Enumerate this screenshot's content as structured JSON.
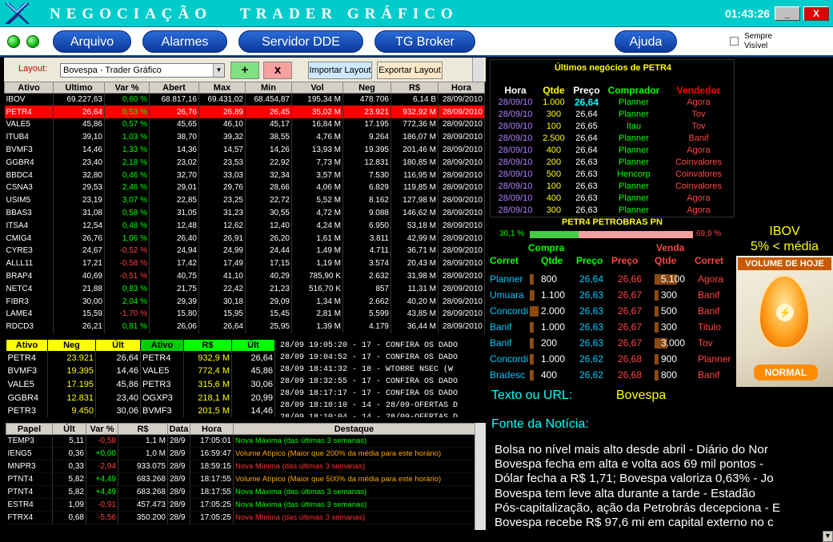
{
  "window": {
    "title": "NEGOCIAÇÃO   TRADER GRÁFICO",
    "clock": "01:43:26",
    "min_label": "_",
    "close_label": "X"
  },
  "menu": {
    "items": [
      "Arquivo",
      "Alarmes",
      "Servidor DDE",
      "TG Broker",
      "Ajuda"
    ],
    "checkbox_label": "Sempre Visível"
  },
  "layout_bar": {
    "label": "Layout:",
    "selected": "Bovespa - Trader Gráfico",
    "add_label": "+",
    "remove_label": "x",
    "import_label": "Importar Layout",
    "export_label": "Exportar Layout"
  },
  "colors": {
    "accent": "#00cccc",
    "button_blue": "#1a55c8",
    "selected_row": "#ff0000",
    "positive": "#00ff00",
    "negative": "#ff4040"
  },
  "quotes": {
    "headers": [
      "Ativo",
      "Ultimo",
      "Var %",
      "Abert",
      "Max",
      "Min",
      "Vol",
      "Neg",
      "R$",
      "Hora"
    ],
    "rows": [
      [
        "IBOV",
        "69.227,63",
        "0,60 %",
        "68.817,16",
        "69.431,02",
        "68.454,87",
        "195,34 M",
        "478.706",
        "6,14 B",
        "28/09/2010"
      ],
      [
        "PETR4",
        "26,64",
        "0,53 %",
        "26,76",
        "26,89",
        "26,45",
        "35,02 M",
        "23.921",
        "932,92 M",
        "28/09/2010"
      ],
      [
        "VALE5",
        "45,86",
        "0,57 %",
        "45,65",
        "46,10",
        "45,17",
        "16,84 M",
        "17.195",
        "772,36 M",
        "28/09/2010"
      ],
      [
        "ITUB4",
        "39,10",
        "1,03 %",
        "38,70",
        "39,32",
        "38,55",
        "4,76 M",
        "9.264",
        "186,07 M",
        "28/09/2010"
      ],
      [
        "BVMF3",
        "14,46",
        "1,33 %",
        "14,36",
        "14,57",
        "14,26",
        "13,93 M",
        "19.395",
        "201,46 M",
        "28/09/2010"
      ],
      [
        "GGBR4",
        "23,40",
        "2,18 %",
        "23,02",
        "23,53",
        "22,92",
        "7,73 M",
        "12.831",
        "180,85 M",
        "28/09/2010"
      ],
      [
        "BBDC4",
        "32,80",
        "0,46 %",
        "32,70",
        "33,03",
        "32,34",
        "3,57 M",
        "7.530",
        "116,95 M",
        "28/09/2010"
      ],
      [
        "CSNA3",
        "29,53",
        "2,46 %",
        "29,01",
        "29,76",
        "28,66",
        "4,06 M",
        "6.829",
        "119,85 M",
        "28/09/2010"
      ],
      [
        "USIM5",
        "23,19",
        "3,07 %",
        "22,85",
        "23,25",
        "22,72",
        "5,52 M",
        "8.162",
        "127,98 M",
        "28/09/2010"
      ],
      [
        "BBAS3",
        "31,08",
        "0,58 %",
        "31,05",
        "31,23",
        "30,55",
        "4,72 M",
        "9.088",
        "146,62 M",
        "28/09/2010"
      ],
      [
        "ITSA4",
        "12,54",
        "0,48 %",
        "12,48",
        "12,62",
        "12,40",
        "4,24 M",
        "6.950",
        "53,18 M",
        "28/09/2010"
      ],
      [
        "CMIG4",
        "26,76",
        "1,06 %",
        "26,40",
        "26,91",
        "26,20",
        "1,61 M",
        "3.811",
        "42,99 M",
        "28/09/2010"
      ],
      [
        "CYRE3",
        "24,67",
        "-0,52 %",
        "24,94",
        "24,99",
        "24,44",
        "1,49 M",
        "4.711",
        "36,71 M",
        "28/09/2010"
      ],
      [
        "ALLL11",
        "17,21",
        "-0,58 %",
        "17,42",
        "17,49",
        "17,15",
        "1,19 M",
        "3.574",
        "20,43 M",
        "28/09/2010"
      ],
      [
        "BRAP4",
        "40,69",
        "-0,51 %",
        "40,75",
        "41,10",
        "40,29",
        "785,90 K",
        "2.632",
        "31,98 M",
        "28/09/2010"
      ],
      [
        "NETC4",
        "21,88",
        "0,83 %",
        "21,75",
        "22,42",
        "21,23",
        "516,70 K",
        "857",
        "11,31 M",
        "28/09/2010"
      ],
      [
        "FIBR3",
        "30,00",
        "2,04 %",
        "29,39",
        "30,18",
        "29,09",
        "1,34 M",
        "2.662",
        "40,20 M",
        "28/09/2010"
      ],
      [
        "LAME4",
        "15,59",
        "-1,70 %",
        "15,80",
        "15,95",
        "15,45",
        "2,81 M",
        "5.599",
        "43,85 M",
        "28/09/2010"
      ],
      [
        "RDCD3",
        "26,21",
        "0,81 %",
        "26,06",
        "26,64",
        "25,95",
        "1,39 M",
        "4.179",
        "36,44 M",
        "28/09/2010"
      ]
    ]
  },
  "ranking": {
    "headers": [
      "Ativo",
      "Neg",
      "Últ",
      "Ativo",
      "R$",
      "Últ"
    ],
    "rows": [
      [
        "PETR4",
        "23.921",
        "26,64",
        "PETR4",
        "932,9 M",
        "26,64"
      ],
      [
        "BVMF3",
        "19.395",
        "14,46",
        "VALE5",
        "772,4 M",
        "45,86"
      ],
      [
        "VALE5",
        "17.195",
        "45,86",
        "PETR3",
        "315,6 M",
        "30,06"
      ],
      [
        "GGBR4",
        "12.831",
        "23,40",
        "OGXP3",
        "218,1 M",
        "20,99"
      ],
      [
        "PETR3",
        "9.450",
        "30,06",
        "BVMF3",
        "201,5 M",
        "14,46"
      ]
    ]
  },
  "ticker": [
    "28/09 19:05:20 - 17 - CONFIRA OS DADO",
    "28/09 19:04:52 - 17 - CONFIRA OS DADO",
    "28/09 18:41:32 - 18 - WTORRE NSEC (W",
    "28/09 18:32:55 - 17 - CONFIRA OS DADO",
    "28/09 18:17:17 - 17 - CONFIRA OS DADO",
    "28/09 18:10:10 - 14 - 28/09-OFERTAS D",
    "28/09 18:10:04 - 14 - 28/09-OFERTAS D"
  ],
  "alerts": {
    "headers": [
      "Papel",
      "Últ",
      "Var %",
      "R$",
      "Data",
      "Hora",
      "Destaque"
    ],
    "rows": [
      [
        "TEMP3",
        "5,11",
        "-0,58",
        "1,1 M",
        "28/9",
        "17:05:01",
        "Nova Máxima (das últimas 3 semanas)",
        "g"
      ],
      [
        "IENG5",
        "0,36",
        "+0,00",
        "1,0 M",
        "28/9",
        "16:59:47",
        "Volume Atípico (Maior que 200% da média para este horário)",
        "o"
      ],
      [
        "MNPR3",
        "0,33",
        "-2,94",
        "933.075",
        "28/9",
        "18:59:15",
        "Nova Mínima (das últimas 3 semanas)",
        "r"
      ],
      [
        "PTNT4",
        "5,82",
        "+4,49",
        "683.268",
        "28/9",
        "18:17:55",
        "Volume Atípico (Maior que 500% da média para este horário)",
        "o"
      ],
      [
        "PTNT4",
        "5,82",
        "+4,49",
        "683.268",
        "28/9",
        "18:17:55",
        "Nova Máxima (das últimas 3 semanas)",
        "g"
      ],
      [
        "ESTR4",
        "1,09",
        "-0,91",
        "457.473",
        "28/9",
        "17:05:25",
        "Nova Máxima (das últimas 3 semanas)",
        "g"
      ],
      [
        "FTRX4",
        "0,68",
        "-5,56",
        "350.200",
        "28/9",
        "17:05:25",
        "Nova Mínima (das últimas 3 semanas)",
        "r"
      ]
    ]
  },
  "last_deals": {
    "title": "Últimos negócios de PETR4",
    "headers": [
      "Hora",
      "Qtde",
      "Preço",
      "Comprador",
      "Vendedor"
    ],
    "rows": [
      [
        "28/09/10",
        "1.000",
        "26,64",
        "Planner",
        "Agora"
      ],
      [
        "28/09/10",
        "300",
        "26,64",
        "Planner",
        "Tov"
      ],
      [
        "28/09/10",
        "100",
        "26,65",
        "Itau",
        "Tov"
      ],
      [
        "28/09/10",
        "2.500",
        "26,64",
        "Planner",
        "Banif"
      ],
      [
        "28/09/10",
        "400",
        "26,64",
        "Planner",
        "Agora"
      ],
      [
        "28/09/10",
        "200",
        "26,63",
        "Planner",
        "Coinvalores"
      ],
      [
        "28/09/10",
        "500",
        "26,63",
        "Hencorp",
        "Coinvalores"
      ],
      [
        "28/09/10",
        "100",
        "26,63",
        "Planner",
        "Coinvalores"
      ],
      [
        "28/09/10",
        "400",
        "26,63",
        "Planner",
        "Agora"
      ],
      [
        "28/09/10",
        "300",
        "26,63",
        "Planner",
        "Agora"
      ]
    ]
  },
  "book": {
    "title": "PETR4  PETROBRAS  PN",
    "buy_pct_label": "30,1 %",
    "sell_pct_label": "69,9 %",
    "buy_fraction": 0.301,
    "buy_label": "Compra",
    "sell_label": "Venda",
    "headers": [
      "Corret",
      "Qtde",
      "Preço",
      "Preço",
      "Qtde",
      "Corret"
    ],
    "rows": [
      [
        "Planner",
        "800",
        "26,64",
        "26,66",
        "5.100",
        "Agora"
      ],
      [
        "Umuara",
        "1.100",
        "26,63",
        "26,67",
        "300",
        "Banif"
      ],
      [
        "Concordi",
        "2.000",
        "26,63",
        "26,67",
        "500",
        "Banif"
      ],
      [
        "Banif",
        "1.000",
        "26,63",
        "26,67",
        "300",
        "Titulo"
      ],
      [
        "Banif",
        "200",
        "26,63",
        "26,67",
        "3.000",
        "Tov"
      ],
      [
        "Concordi",
        "1.000",
        "26,62",
        "26,68",
        "900",
        "Planner"
      ],
      [
        "Bradesc",
        "400",
        "26,62",
        "26,68",
        "800",
        "Banif"
      ]
    ]
  },
  "gain_panel": {
    "line1": "IBOV",
    "line2": "5% < média",
    "header": "VOLUME DE HOJE",
    "label": "NORMAL"
  },
  "news": {
    "url_label": "Texto ou URL:",
    "url_value": "Bovespa",
    "source_label": "Fonte da Notícia:",
    "headlines": [
      "Bolsa no nível mais alto desde abril - Diário do Nor",
      "Bovespa fecha em alta e volta aos 69 mil pontos -",
      "Dólar fecha a R$ 1,71; Bovespa valoriza 0,63% - Jo",
      "Bovespa tem leve alta durante a tarde - Estadão",
      "Pós-capitalização, ação da Petrobrás decepciona - E",
      "Bovespa recebe R$ 97,6 mi em capital externo no c"
    ]
  }
}
